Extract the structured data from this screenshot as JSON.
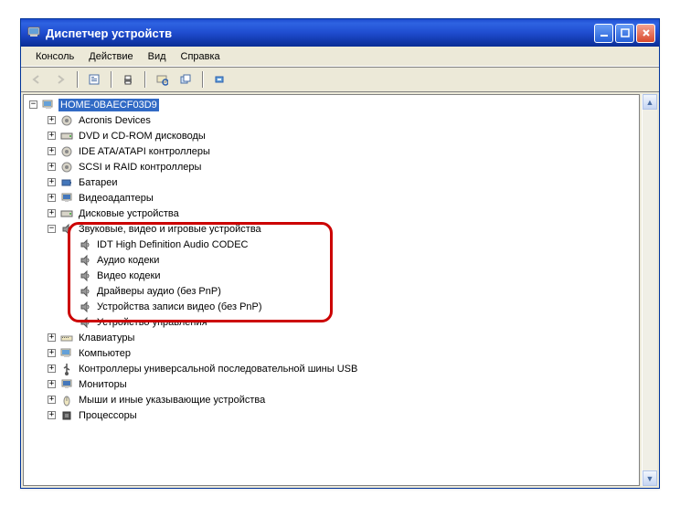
{
  "window": {
    "title": "Диспетчер устройств"
  },
  "menu": {
    "console": "Консоль",
    "action": "Действие",
    "view": "Вид",
    "help": "Справка"
  },
  "tree": {
    "root": "HOME-0BAECF03D9",
    "items": [
      "Acronis Devices",
      "DVD и CD-ROM дисководы",
      "IDE ATA/ATAPI контроллеры",
      "SCSI и RAID контроллеры",
      "Батареи",
      "Видеоадаптеры",
      "Дисковые устройства"
    ],
    "expanded_label": "Звуковые, видео и игровые устройства",
    "expanded_children": [
      "IDT High Definition Audio CODEC",
      "Аудио кодеки",
      "Видео кодеки",
      "Драйверы аудио (без PnP)",
      "Устройства записи видео (без PnP)",
      "Устройство управления"
    ],
    "items_after": [
      "Клавиатуры",
      "Компьютер",
      "Контроллеры универсальной последовательной шины USB",
      "Мониторы",
      "Мыши и иные указывающие устройства",
      "Процессоры"
    ]
  }
}
